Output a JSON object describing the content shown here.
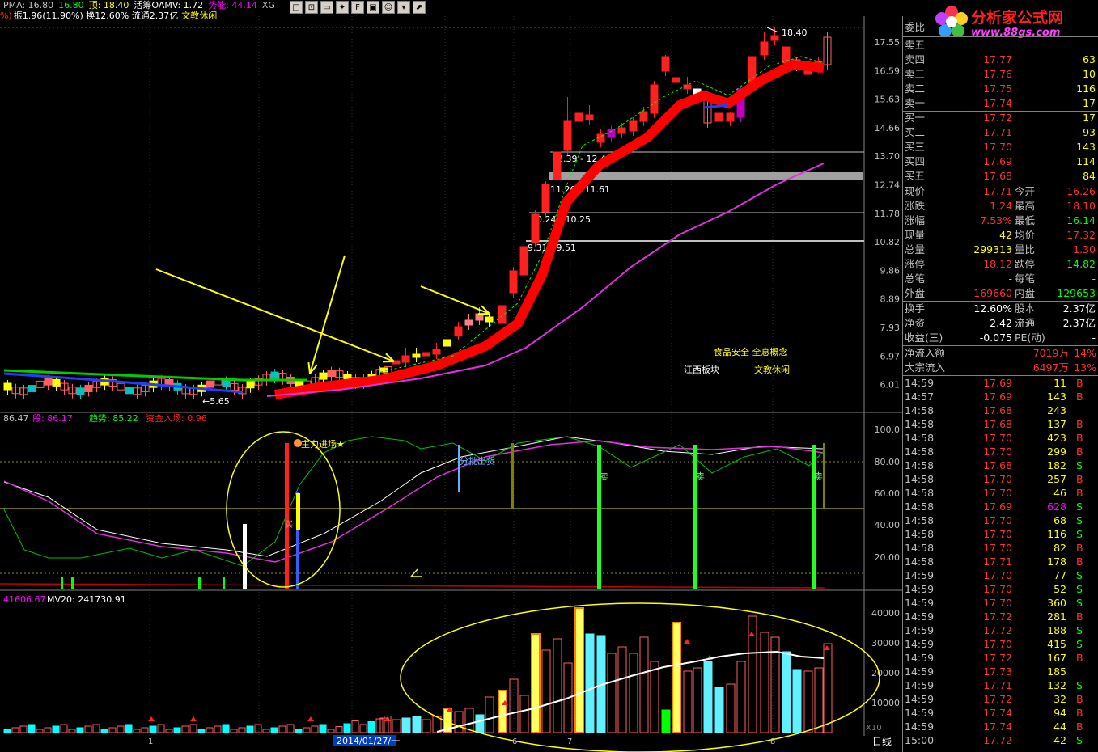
{
  "header": {
    "line1": [
      {
        "text": "PMA: 16.80",
        "color": "#c0c0c0"
      },
      {
        "text": "16.80",
        "color": "#00ff00"
      },
      {
        "text": "顶: 18.40",
        "color": "#ffff00"
      },
      {
        "text": "活筹OAMV: 1.72",
        "color": "#ffffff"
      },
      {
        "text": "势能: 44.14",
        "color": "#ff00ff"
      },
      {
        "text": "XG",
        "color": "#c0c0c0"
      }
    ],
    "line2_prefix": "%)",
    "line2": "振1.96(11.90%) 换12.60% 流通2.37亿",
    "line2_tag": "文教休闲"
  },
  "toolbar": [
    "□",
    "⊡",
    "▭",
    "✦",
    "F",
    "▣",
    "☺",
    "▾",
    "⬈"
  ],
  "logo": {
    "title": "分析家公式网",
    "url": "www.88gs.com"
  },
  "main_chart": {
    "price_ticks": [
      "17.55",
      "16.59",
      "15.63",
      "14.66",
      "13.70",
      "12.74",
      "11.78",
      "10.82",
      "9.86",
      "8.89",
      "7.93",
      "6.97",
      "6.01"
    ],
    "high_label": "18.40",
    "low_label": "←5.65",
    "zones": [
      "12.39 - 12.42",
      "11.26 - 11.61",
      "10.24 - 10.25",
      "9.31 - 9.51"
    ],
    "concepts": [
      {
        "text": "食品安全 全息概念",
        "color": "#ffff00"
      },
      {
        "text": "江西板块",
        "color": "#ffffff"
      },
      {
        "text": "文教休闲",
        "color": "#ffff00"
      }
    ]
  },
  "indicator": {
    "header": [
      {
        "text": "86.47",
        "color": "#c0c0c0"
      },
      {
        "text": "段: 86.17",
        "color": "#ff00ff"
      },
      {
        "text": "趋势: 85.22",
        "color": "#00ff00"
      },
      {
        "text": "资金入场: 0.96",
        "color": "#ff2020"
      }
    ],
    "ticks": [
      "100.0",
      "80.00",
      "60.00",
      "40.00",
      "20.00"
    ],
    "annotations": {
      "main_in": "主力进场★",
      "batch_out": "分批出货",
      "sell": "卖",
      "buy_small": "买"
    }
  },
  "volume": {
    "header": [
      {
        "text": "41606.67",
        "color": "#ff00ff"
      },
      {
        "text": "MV20: 241730.91",
        "color": "#ffffff"
      }
    ],
    "ticks": [
      "40000",
      "30000",
      "20000",
      "10000"
    ],
    "unit": "X10",
    "date_label": "2014/01/27/一",
    "x_marks": [
      "1",
      "6",
      "7",
      "8"
    ]
  },
  "quote_panel": {
    "weibi_label": "委比",
    "asks": [
      {
        "label": "卖五",
        "price": "",
        "vol": ""
      },
      {
        "label": "卖四",
        "price": "17.77",
        "vol": "63"
      },
      {
        "label": "卖三",
        "price": "17.76",
        "vol": "10"
      },
      {
        "label": "卖二",
        "price": "17.75",
        "vol": "116"
      },
      {
        "label": "卖一",
        "price": "17.74",
        "vol": "17"
      }
    ],
    "bids": [
      {
        "label": "买一",
        "price": "17.72",
        "vol": "17"
      },
      {
        "label": "买二",
        "price": "17.71",
        "vol": "93"
      },
      {
        "label": "买三",
        "price": "17.70",
        "vol": "143"
      },
      {
        "label": "买四",
        "price": "17.69",
        "vol": "114"
      },
      {
        "label": "买五",
        "price": "17.68",
        "vol": "84"
      }
    ],
    "stats": [
      {
        "l1": "现价",
        "v1": "17.71",
        "c1": "#ff3030",
        "l2": "今开",
        "v2": "16.26",
        "c2": "#ff3030"
      },
      {
        "l1": "涨跌",
        "v1": "1.24",
        "c1": "#ff3030",
        "l2": "最高",
        "v2": "18.10",
        "c2": "#ff3030"
      },
      {
        "l1": "涨幅",
        "v1": "7.53%",
        "c1": "#ff3030",
        "l2": "最低",
        "v2": "16.14",
        "c2": "#00ff00"
      },
      {
        "l1": "现量",
        "v1": "42",
        "c1": "#ffff00",
        "l2": "均价",
        "v2": "17.32",
        "c2": "#ff3030"
      },
      {
        "l1": "总量",
        "v1": "299313",
        "c1": "#ffff00",
        "l2": "量比",
        "v2": "1.30",
        "c2": "#ff3030"
      },
      {
        "l1": "涨停",
        "v1": "18.12",
        "c1": "#ff3030",
        "l2": "跌停",
        "v2": "14.82",
        "c2": "#00ff00"
      },
      {
        "l1": "总笔",
        "v1": "-",
        "c1": "#c0c0c0",
        "l2": "每笔",
        "v2": "-",
        "c2": "#c0c0c0"
      },
      {
        "l1": "外盘",
        "v1": "169660",
        "c1": "#ff3030",
        "l2": "内盘",
        "v2": "129653",
        "c2": "#00ff00"
      }
    ],
    "stats2": [
      {
        "l1": "换手",
        "v1": "12.60%",
        "c1": "#ffffff",
        "l2": "股本",
        "v2": "2.37亿",
        "c2": "#ffffff"
      },
      {
        "l1": "净资",
        "v1": "2.42",
        "c1": "#ffffff",
        "l2": "流通",
        "v2": "2.37亿",
        "c2": "#ffffff"
      },
      {
        "l1": "收益(三)",
        "v1": "-0.075",
        "c1": "#ffffff",
        "l2": "PE(动)",
        "v2": "-",
        "c2": "#ffffff"
      }
    ],
    "flows": [
      {
        "label": "净流入额",
        "value": "7019万",
        "pct": "14%"
      },
      {
        "label": "大宗流入",
        "value": "6497万",
        "pct": "13%"
      }
    ],
    "ticks": [
      {
        "t": "14:59",
        "p": "17.69",
        "v": "11",
        "s": "B"
      },
      {
        "t": "14:57",
        "p": "17.69",
        "v": "143",
        "s": "B"
      },
      {
        "t": "14:58",
        "p": "17.68",
        "v": "243",
        "s": ""
      },
      {
        "t": "14:58",
        "p": "17.68",
        "v": "137",
        "s": "B"
      },
      {
        "t": "14:58",
        "p": "17.70",
        "v": "423",
        "s": "B"
      },
      {
        "t": "14:58",
        "p": "17.70",
        "v": "299",
        "s": "B"
      },
      {
        "t": "14:58",
        "p": "17.68",
        "v": "182",
        "s": "S"
      },
      {
        "t": "14:58",
        "p": "17.70",
        "v": "257",
        "s": "B"
      },
      {
        "t": "14:58",
        "p": "17.70",
        "v": "46",
        "s": "B"
      },
      {
        "t": "14:58",
        "p": "17.69",
        "v": "628",
        "s": "S"
      },
      {
        "t": "14:58",
        "p": "17.70",
        "v": "68",
        "s": "S"
      },
      {
        "t": "14:58",
        "p": "17.70",
        "v": "116",
        "s": "S"
      },
      {
        "t": "14:58",
        "p": "17.70",
        "v": "82",
        "s": "B"
      },
      {
        "t": "14:58",
        "p": "17.71",
        "v": "178",
        "s": "B"
      },
      {
        "t": "14:59",
        "p": "17.70",
        "v": "77",
        "s": "S"
      },
      {
        "t": "14:59",
        "p": "17.70",
        "v": "52",
        "s": "S"
      },
      {
        "t": "14:59",
        "p": "17.70",
        "v": "360",
        "s": "S"
      },
      {
        "t": "14:59",
        "p": "17.72",
        "v": "281",
        "s": "B"
      },
      {
        "t": "14:59",
        "p": "17.72",
        "v": "188",
        "s": "S"
      },
      {
        "t": "14:59",
        "p": "17.70",
        "v": "415",
        "s": "S"
      },
      {
        "t": "14:59",
        "p": "17.72",
        "v": "167",
        "s": "B"
      },
      {
        "t": "14:59",
        "p": "17.73",
        "v": "185",
        "s": ""
      },
      {
        "t": "14:59",
        "p": "17.71",
        "v": "132",
        "s": "S"
      },
      {
        "t": "14:59",
        "p": "17.72",
        "v": "32",
        "s": "B"
      },
      {
        "t": "14:59",
        "p": "17.74",
        "v": "94",
        "s": "B"
      },
      {
        "t": "14:59",
        "p": "17.74",
        "v": "44",
        "s": "B"
      },
      {
        "t": "15:00",
        "p": "17.72",
        "v": "42",
        "s": "S"
      }
    ]
  },
  "bottom": {
    "period": "日线"
  },
  "colors": {
    "up": "#ff3030",
    "down": "#00ffff",
    "label": "#c0c0c0",
    "yellow": "#ffff00"
  }
}
